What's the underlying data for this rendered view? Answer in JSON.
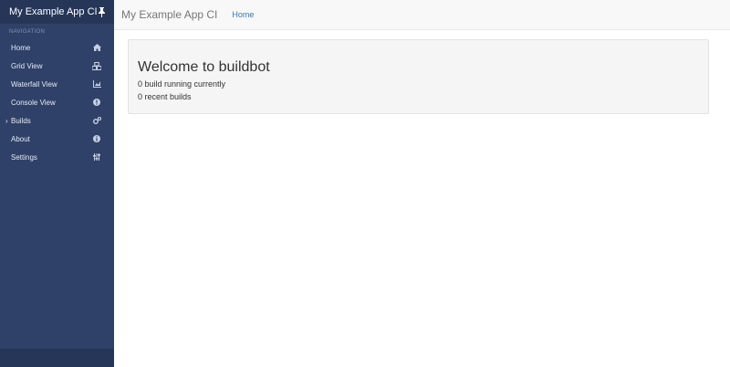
{
  "sidebar": {
    "app_title": "My Example App CI",
    "nav_heading": "NAVIGATION",
    "items": [
      {
        "label": "Home",
        "icon": "home-icon"
      },
      {
        "label": "Grid View",
        "icon": "cubes-icon"
      },
      {
        "label": "Waterfall View",
        "icon": "area-chart-icon"
      },
      {
        "label": "Console View",
        "icon": "exclamation-circle-icon"
      },
      {
        "label": "Builds",
        "icon": "gears-icon",
        "expandable": true
      },
      {
        "label": "About",
        "icon": "info-circle-icon"
      },
      {
        "label": "Settings",
        "icon": "sliders-icon"
      }
    ]
  },
  "topbar": {
    "title": "My Example App CI",
    "breadcrumb": "Home"
  },
  "main": {
    "welcome_title": "Welcome to buildbot",
    "builds_running": "0 build running currently",
    "recent_builds": "0 recent builds"
  },
  "colors": {
    "sidebar_bg": "#2f4169",
    "sidebar_header_bg": "#263658",
    "link": "#337ab7"
  }
}
